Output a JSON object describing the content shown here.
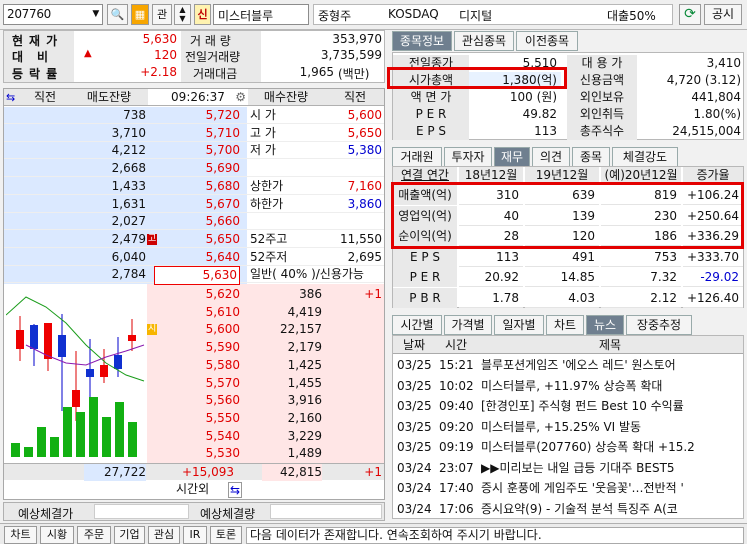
{
  "topbar": {
    "code": "207760",
    "btn_q": "⍰",
    "btn_kwan": "관",
    "btn_sin": "신",
    "name": "미스터블루",
    "category": "중형주",
    "market": "KOSDAQ",
    "sector": "디지털",
    "loan": "대출50%",
    "share": "공시"
  },
  "summary": {
    "label_price": "현재가",
    "label_change": "대비",
    "label_rate": "등락률",
    "price": "5,630",
    "change": "120",
    "rate": "+2.18",
    "vol_label": "거 래 량",
    "prev_vol_label": "전일거래량",
    "amount_label": "거래대금",
    "vol": "353,970",
    "prev_vol": "3,735,599",
    "amount": "1,965",
    "amount_unit": "(백만)"
  },
  "orderbook": {
    "head": {
      "c1": "직전",
      "c2": "매도잔량",
      "time": "09:26:37",
      "c4": "매수잔량",
      "c5": "직전"
    },
    "asks": [
      {
        "qty": "738",
        "price": "5,720",
        "label": "시  가",
        "val": "5,600",
        "vcolor": "#e00000"
      },
      {
        "qty": "3,710",
        "price": "5,710",
        "label": "고  가",
        "val": "5,650",
        "vcolor": "#e00000"
      },
      {
        "qty": "4,212",
        "price": "5,700",
        "label": "저  가",
        "val": "5,380",
        "vcolor": "#0000d0"
      },
      {
        "qty": "2,668",
        "price": "5,690",
        "label": "",
        "val": "",
        "vcolor": "#111"
      },
      {
        "qty": "1,433",
        "price": "5,680",
        "label": "상한가",
        "val": "7,160",
        "vcolor": "#e00000"
      },
      {
        "qty": "1,631",
        "price": "5,670",
        "label": "하한가",
        "val": "3,860",
        "vcolor": "#0000d0"
      },
      {
        "qty": "2,027",
        "price": "5,660",
        "label": "",
        "val": "",
        "vcolor": "#111"
      },
      {
        "qty": "2,479",
        "price": "5,650",
        "label": "52주고",
        "val": "11,550",
        "vcolor": "#111",
        "mark": "고"
      },
      {
        "qty": "6,040",
        "price": "5,640",
        "label": "52주저",
        "val": "2,695",
        "vcolor": "#111"
      },
      {
        "qty": "2,784",
        "price": "5,630",
        "label": "일반( 40% )/신용가능",
        "val": "",
        "vcolor": "#111"
      }
    ],
    "bids": [
      {
        "price": "5,620",
        "qty": "386",
        "prev": "+1"
      },
      {
        "price": "5,610",
        "qty": "4,419",
        "prev": ""
      },
      {
        "price": "5,600",
        "qty": "22,157",
        "prev": "",
        "mark": "시"
      },
      {
        "price": "5,590",
        "qty": "2,179",
        "prev": ""
      },
      {
        "price": "5,580",
        "qty": "1,425",
        "prev": ""
      },
      {
        "price": "5,570",
        "qty": "1,455",
        "prev": ""
      },
      {
        "price": "5,560",
        "qty": "3,916",
        "prev": ""
      },
      {
        "price": "5,550",
        "qty": "2,160",
        "prev": ""
      },
      {
        "price": "5,540",
        "qty": "3,229",
        "prev": ""
      },
      {
        "price": "5,530",
        "qty": "1,489",
        "prev": ""
      }
    ],
    "total": {
      "ask": "27,722",
      "diff": "+15,093",
      "bid": "42,815",
      "prev": "+1"
    },
    "after": "시간외",
    "est_buy": "예상체결가",
    "est_qty": "예상체결량"
  },
  "info": {
    "tabs": [
      "종목정보",
      "관심종목",
      "이전종목"
    ],
    "rows": [
      {
        "l": "전일종가",
        "v": "5,510",
        "l2": "대 용 가",
        "v2": "3,410"
      },
      {
        "l": "시가총액",
        "v": "1,380(억)",
        "l2": "신용금액",
        "v2": "4,720  (3.12)"
      },
      {
        "l": "액 면 가",
        "v": "100 (원)",
        "l2": "외인보유",
        "v2": "441,804"
      },
      {
        "l": "P E R",
        "v": "49.82",
        "l2": "외인취득",
        "v2": "1.80(%)"
      },
      {
        "l": "E P S",
        "v": "113",
        "l2": "총주식수",
        "v2": "24,515,004"
      }
    ]
  },
  "fin": {
    "tabs": [
      "거래원",
      "투자자",
      "재무",
      "의견",
      "종목",
      "체결강도"
    ],
    "head": [
      "연결  연간",
      "18년12월",
      "19년12월",
      "(예)20년12월",
      "증가율"
    ],
    "rows": [
      {
        "l": "매출액(억)",
        "a": "310",
        "b": "639",
        "c": "819",
        "d": "+106.24"
      },
      {
        "l": "영업익(억)",
        "a": "40",
        "b": "139",
        "c": "230",
        "d": "+250.64"
      },
      {
        "l": "순이익(억)",
        "a": "28",
        "b": "120",
        "c": "186",
        "d": "+336.29"
      },
      {
        "l": "E P S",
        "a": "113",
        "b": "491",
        "c": "753",
        "d": "+333.70"
      },
      {
        "l": "P E R",
        "a": "20.92",
        "b": "14.85",
        "c": "7.32",
        "d": "-29.02"
      },
      {
        "l": "P B R",
        "a": "1.78",
        "b": "4.03",
        "c": "2.12",
        "d": "+126.40"
      }
    ]
  },
  "news": {
    "tabs": [
      "시간별",
      "가격별",
      "일자별",
      "차트",
      "뉴스",
      "장중추정"
    ],
    "head": [
      "날짜",
      "시간",
      "제목"
    ],
    "rows": [
      {
        "d": "03/25",
        "t": "15:21",
        "title": "블루포션게임즈 '에오스 레드' 원스토어"
      },
      {
        "d": "03/25",
        "t": "10:02",
        "title": "미스터블루, +11.97% 상승폭 확대"
      },
      {
        "d": "03/25",
        "t": "09:40",
        "title": "[한경인포] 주식형 펀드 Best 10 수익률"
      },
      {
        "d": "03/25",
        "t": "09:20",
        "title": "미스터블루, +15.25% VI 발동"
      },
      {
        "d": "03/25",
        "t": "09:19",
        "title": "미스터블루(207760)  상승폭 확대 +15.2"
      },
      {
        "d": "03/24",
        "t": "23:07",
        "title": "▶▶미리보는 내일 급등 기대주 BEST5"
      },
      {
        "d": "03/24",
        "t": "17:40",
        "title": "증시 훈풍에 게임주도 '웃음꽃'…전반적 '"
      },
      {
        "d": "03/24",
        "t": "17:06",
        "title": "증시요약(9) - 기술적 분석 특징주 A(코"
      }
    ]
  },
  "status": {
    "buttons": [
      "차트",
      "시황",
      "주문",
      "기업",
      "관심",
      "IR",
      "토론"
    ],
    "message": "다음 데이터가 존재합니다. 연속조회하여 주시기 바랍니다."
  }
}
